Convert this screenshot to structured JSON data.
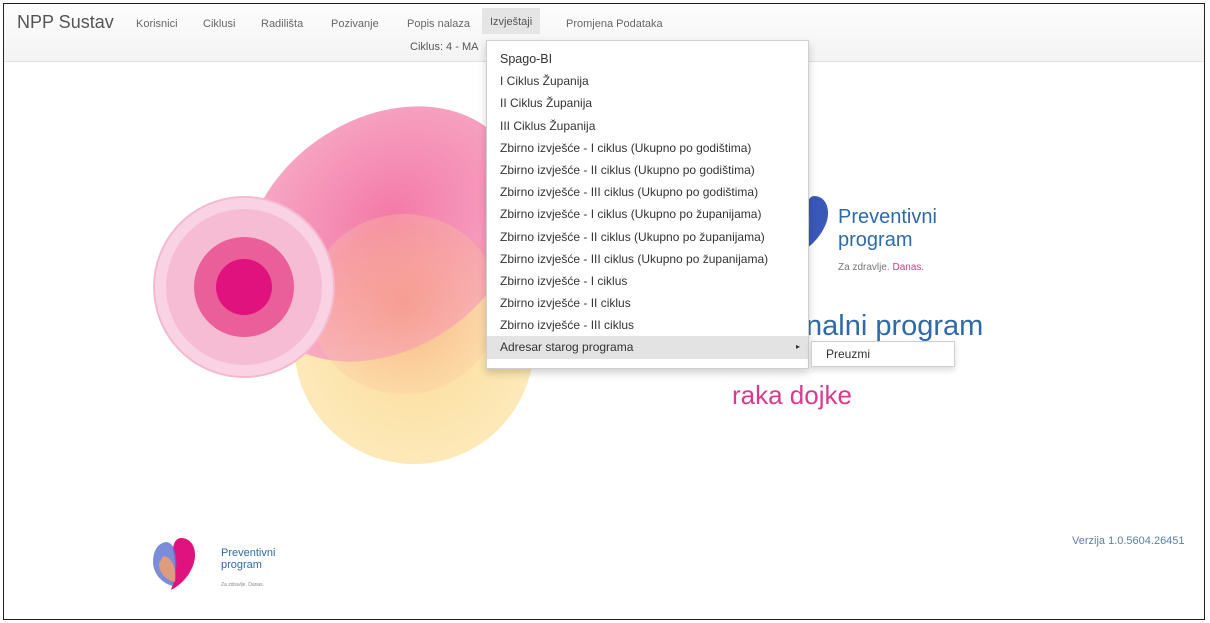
{
  "navbar": {
    "brand": "NPP Sustav",
    "items": [
      {
        "label": "Korisnici"
      },
      {
        "label": "Ciklusi"
      },
      {
        "label": "Radilišta"
      },
      {
        "label": "Pozivanje"
      },
      {
        "label": "Popis nalaza"
      },
      {
        "label": "Izvještaji",
        "active": true
      },
      {
        "label": "Promjena Podataka"
      }
    ],
    "subtext": "Ciklus: 4 - MA"
  },
  "dropdown": {
    "items": [
      "Spago-BI",
      "I Ciklus Županija",
      "II Ciklus Županija",
      "III Ciklus Županija",
      "Zbirno izvješće - I ciklus (Ukupno po godištima)",
      "Zbirno izvješće - II ciklus (Ukupno po godištima)",
      "Zbirno izvješće - III ciklus (Ukupno po godištima)",
      "Zbirno izvješće - I ciklus (Ukupno po županijama)",
      "Zbirno izvješće - II ciklus (Ukupno po županijama)",
      "Zbirno izvješće - III ciklus (Ukupno po županijama)",
      "Zbirno izvješće - I ciklus",
      "Zbirno izvješće - II ciklus",
      "Zbirno izvješće - III ciklus"
    ],
    "submenu_parent": "Adresar starog programa",
    "submenu_items": [
      "Preuzmi"
    ]
  },
  "hero": {
    "logo_title_1": "Preventivni",
    "logo_title_2": "program",
    "logo_tag_prefix": "Za zdravlje.",
    "logo_tag_accent": "Danas.",
    "headline_1": "nalni program",
    "headline_2": "raka dojke"
  },
  "footer": {
    "version": "Verzija 1.0.5604.26451",
    "logo_title_1": "Preventivni",
    "logo_title_2": "program",
    "logo_tag": "Za zdravlje. Danas."
  },
  "colors": {
    "brand_blue": "#2f6aa8",
    "brand_pink": "#d93a8e",
    "menu_hover": "#e3e3e3"
  },
  "icons": {
    "submenu_caret": "caret-right-icon"
  }
}
